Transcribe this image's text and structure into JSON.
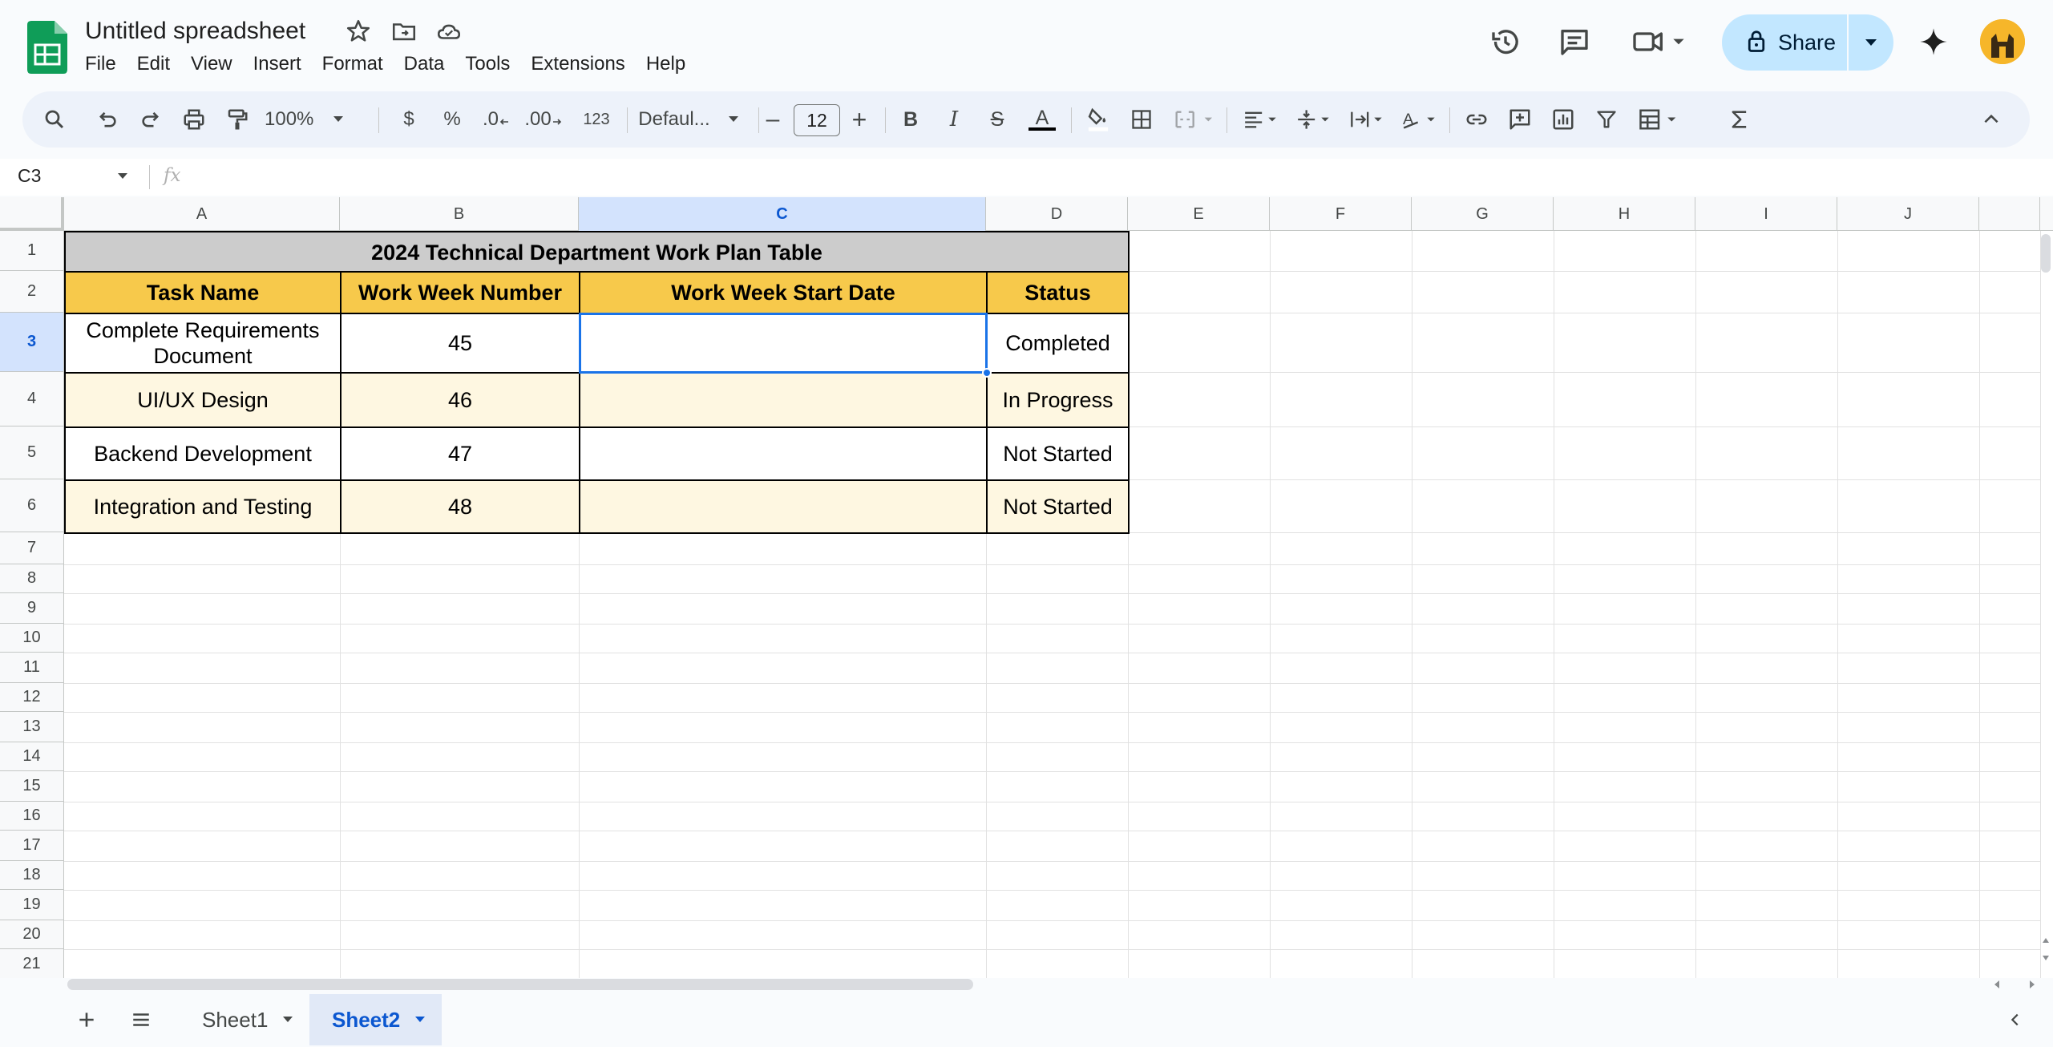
{
  "app": {
    "doc_title": "Untitled spreadsheet",
    "menu": [
      "File",
      "Edit",
      "View",
      "Insert",
      "Format",
      "Data",
      "Tools",
      "Extensions",
      "Help"
    ],
    "share_label": "Share",
    "colors": {
      "accent": "#0b57d0",
      "share_bg": "#c2e7ff",
      "header_yellow": "#f7c94b",
      "title_gray": "#cccccc",
      "band_cream": "#fef7e1"
    }
  },
  "toolbar": {
    "zoom": "100%",
    "currency": "$",
    "percent": "%",
    "dec_decrease": ".0",
    "dec_increase": ".00",
    "more_formats": "123",
    "font_name": "Defaul...",
    "font_size": "12",
    "minus": "–",
    "plus": "+",
    "bold": "B",
    "italic": "I",
    "strike": "S",
    "text_color": "A"
  },
  "formula_bar": {
    "name_box": "C3",
    "fx": "fx",
    "content": ""
  },
  "grid": {
    "columns": [
      "A",
      "B",
      "C",
      "D",
      "E",
      "F",
      "G",
      "H",
      "I",
      "J"
    ],
    "rows": [
      "1",
      "2",
      "3",
      "4",
      "5",
      "6",
      "7",
      "8",
      "9",
      "10",
      "11",
      "12",
      "13",
      "14",
      "15",
      "16",
      "17",
      "18",
      "19",
      "20",
      "21"
    ],
    "selected_col": "C",
    "selected_row": "3"
  },
  "table": {
    "title": "2024 Technical Department Work Plan Table",
    "headers": [
      "Task Name",
      "Work Week Number",
      "Work Week Start Date",
      "Status"
    ],
    "rows": [
      [
        "Complete Requirements Document",
        "45",
        "",
        "Completed"
      ],
      [
        "UI/UX Design",
        "46",
        "",
        "In Progress"
      ],
      [
        "Backend Development",
        "47",
        "",
        "Not Started"
      ],
      [
        "Integration and Testing",
        "48",
        "",
        "Not Started"
      ]
    ]
  },
  "sheets": {
    "tabs": [
      "Sheet1",
      "Sheet2"
    ],
    "active": "Sheet2"
  }
}
